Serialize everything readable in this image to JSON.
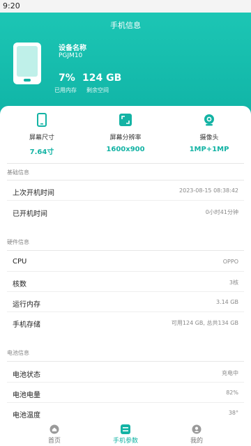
{
  "status_bar": {
    "time": "9:20"
  },
  "header": {
    "title": "手机信息",
    "device_name_label": "设备名称",
    "device_model": "PGJM10",
    "memory_used_pct": "7%",
    "memory_used_label": "已用内存",
    "storage_free": "124 GB",
    "storage_free_label": "剩余空间"
  },
  "specs": [
    {
      "icon": "phone-icon",
      "label": "屏幕尺寸",
      "value": "7.64寸"
    },
    {
      "icon": "resolution-icon",
      "label": "屏幕分辨率",
      "value": "1600x900"
    },
    {
      "icon": "camera-icon",
      "label": "摄像头",
      "value": "1MP+1MP"
    }
  ],
  "sections": {
    "basic": {
      "title": "基础信息",
      "rows": [
        {
          "label": "上次开机时间",
          "value": "2023-08-15 08:38:42"
        },
        {
          "label": "已开机时间",
          "value": "0小时41分钟"
        }
      ]
    },
    "hardware": {
      "title": "硬件信息",
      "rows": [
        {
          "label": "CPU",
          "value": "OPPO"
        },
        {
          "label": "核数",
          "value": "3核"
        },
        {
          "label": "运行内存",
          "value": "3.14 GB"
        },
        {
          "label": "手机存储",
          "value": "可用124 GB, 总共134 GB"
        }
      ]
    },
    "battery": {
      "title": "电池信息",
      "rows": [
        {
          "label": "电池状态",
          "value": "充电中"
        },
        {
          "label": "电池电量",
          "value": "82%"
        },
        {
          "label": "电池温度",
          "value": "38°"
        }
      ]
    }
  },
  "nav": {
    "items": [
      {
        "icon": "home-icon",
        "label": "首页"
      },
      {
        "icon": "phone-params-icon",
        "label": "手机参数"
      },
      {
        "icon": "profile-icon",
        "label": "我的"
      }
    ],
    "active_index": 1
  },
  "colors": {
    "accent": "#13b3a4",
    "header_gradient_top": "#1ec8b6",
    "header_gradient_bottom": "#10b4a6"
  }
}
